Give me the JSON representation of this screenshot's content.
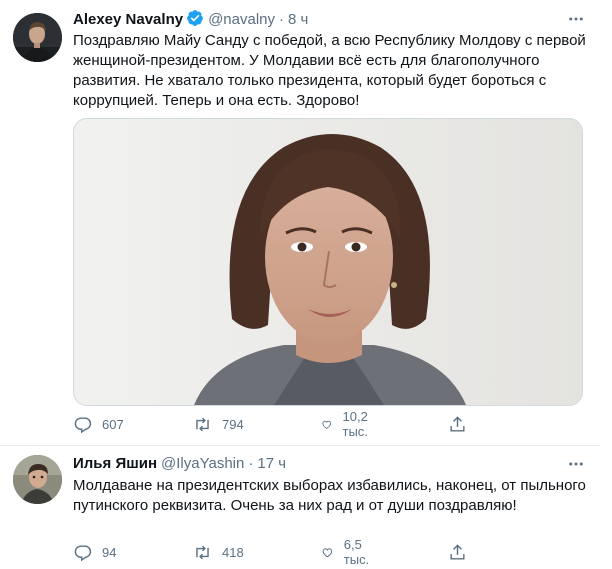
{
  "tweets": [
    {
      "name": "Alexey Navalny",
      "verified": true,
      "handle": "@navalny",
      "time": "8 ч",
      "text": "Поздравляю Майу Санду с победой, а всю Республику Молдову с первой женщиной-президентом. У Молдавии всё есть для благополучного развития. Не хватало только президента, который будет бороться с коррупцией. Теперь и она есть. Здорово!",
      "has_media": true,
      "replies": "607",
      "retweets": "794",
      "likes": "10,2 тыс."
    },
    {
      "name": "Илья Яшин",
      "verified": false,
      "handle": "@IlyaYashin",
      "time": "17 ч",
      "text": "Молдаване на президентских выборах избавились, наконец, от пыльного путинского реквизита. Очень за них рад и от души поздравляю!",
      "has_media": false,
      "replies": "94",
      "retweets": "418",
      "likes": "6,5 тыс."
    }
  ],
  "colors": {
    "text": "#0f1419",
    "secondary": "#5b7083",
    "verified": "#1da1f2",
    "divider": "#e6ecf0"
  },
  "icons": [
    "verified-badge-icon",
    "more-icon",
    "reply-icon",
    "retweet-icon",
    "like-icon",
    "share-icon"
  ]
}
